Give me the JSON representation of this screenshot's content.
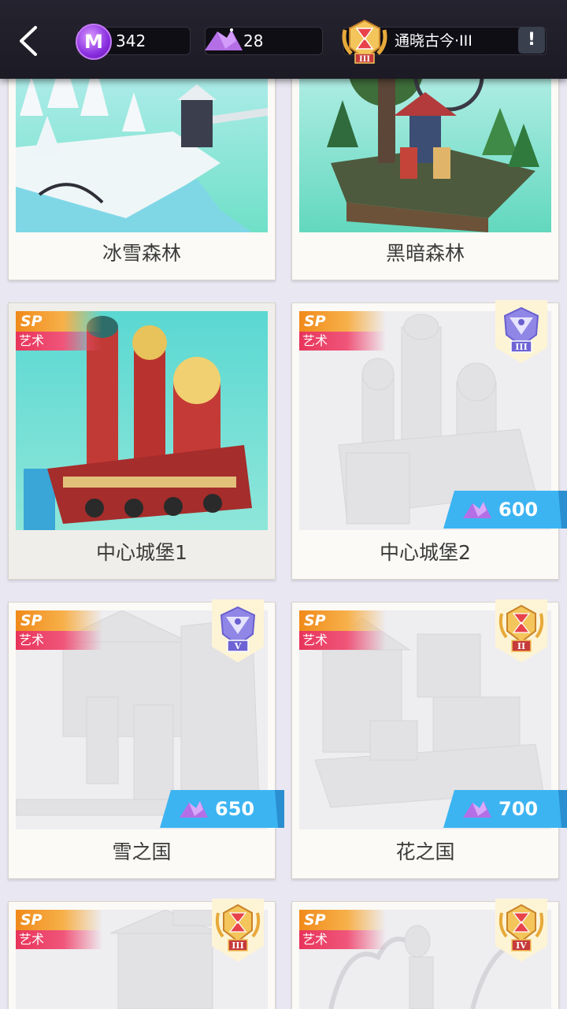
{
  "header": {
    "m_currency": "342",
    "purple_currency": "28",
    "player_title": "通晓古今·III",
    "alert_label": "!",
    "m_icon_letter": "M"
  },
  "cards": [
    {
      "name": "冰雪森林",
      "sp": "",
      "art": "",
      "price": "",
      "rank": ""
    },
    {
      "name": "黑暗森林",
      "sp": "",
      "art": "",
      "price": "",
      "rank": ""
    },
    {
      "name": "中心城堡1",
      "sp": "SP",
      "art": "艺术",
      "price": "",
      "rank": ""
    },
    {
      "name": "中心城堡2",
      "sp": "SP",
      "art": "艺术",
      "price": "600",
      "rank": "III"
    },
    {
      "name": "雪之国",
      "sp": "SP",
      "art": "艺术",
      "price": "650",
      "rank": "V"
    },
    {
      "name": "花之国",
      "sp": "SP",
      "art": "艺术",
      "price": "700",
      "rank": "II"
    },
    {
      "name": "",
      "sp": "SP",
      "art": "艺术",
      "price": "",
      "rank": "III"
    },
    {
      "name": "",
      "sp": "SP",
      "art": "艺术",
      "price": "",
      "rank": "IV"
    }
  ],
  "colors": {
    "price_badge": "#3cb4f2",
    "sp_orange": "#f08a1a",
    "art_pink": "#e8345a",
    "m_purple": "#8a2fe0"
  },
  "icons": [
    "back-arrow-icon",
    "m-coin-icon",
    "purple-pile-icon",
    "title-medal-icon",
    "alert-icon",
    "rank-shield-icon"
  ]
}
